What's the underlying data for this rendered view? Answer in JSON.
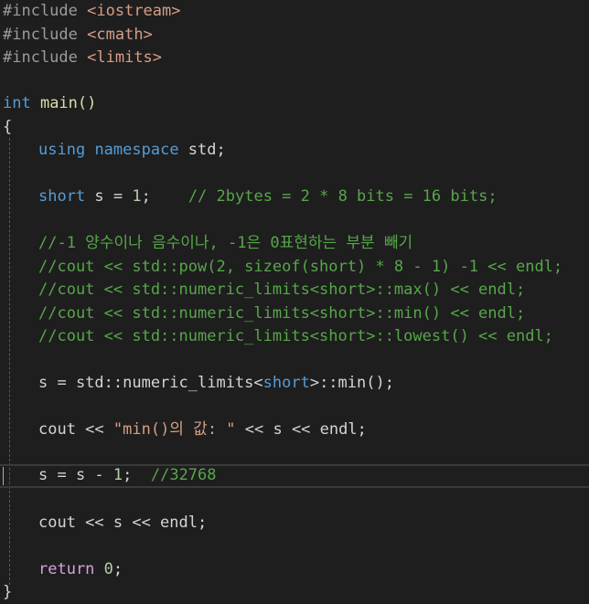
{
  "editor": {
    "lines": {
      "l1": {
        "pre": "#include",
        "inc": "<iostream>"
      },
      "l2": {
        "pre": "#include",
        "inc": "<cmath>"
      },
      "l3": {
        "pre": "#include",
        "inc": "<limits>"
      },
      "l5": {
        "kw": "int",
        "rest": " main()"
      },
      "l6": {
        "brace": "{"
      },
      "l7": {
        "kw1": "using",
        "kw2": "namespace",
        "rest": " std;"
      },
      "l9": {
        "kw": "short",
        "rest": " s = ",
        "num": "1",
        "semi": ";",
        "cmt": "    // 2bytes = 2 * 8 bits = 16 bits;"
      },
      "l11": {
        "cmt": "//-1 양수이나 음수이나, -1은 0표현하는 부분 빼기"
      },
      "l12": {
        "cmt": "//cout << std::pow(2, sizeof(short) * 8 - 1) -1 << endl;"
      },
      "l13": {
        "cmt": "//cout << std::numeric_limits<short>::max() << endl;"
      },
      "l14": {
        "cmt": "//cout << std::numeric_limits<short>::min() << endl;"
      },
      "l15": {
        "cmt": "//cout << std::numeric_limits<short>::lowest() << endl;"
      },
      "l17": {
        "a": "s = std::numeric_limits<",
        "type": "short",
        "b": ">::min();"
      },
      "l19": {
        "a": "cout << ",
        "str": "\"min()의 값: \"",
        "b": " << s << endl;"
      },
      "l21": {
        "a": "s = s - ",
        "num": "1",
        "b": ";  ",
        "cmt": "//32768"
      },
      "l23": {
        "a": "cout << s << endl;"
      },
      "l25": {
        "kw": "return",
        "sp": " ",
        "num": "0",
        "b": ";"
      },
      "l26": {
        "brace": "}"
      }
    },
    "colors": {
      "background": "#1e1e1e",
      "keyword": "#569cd6",
      "control": "#d8a0df",
      "comment": "#57a64a",
      "string": "#d69d85",
      "number": "#b5cea8"
    }
  }
}
